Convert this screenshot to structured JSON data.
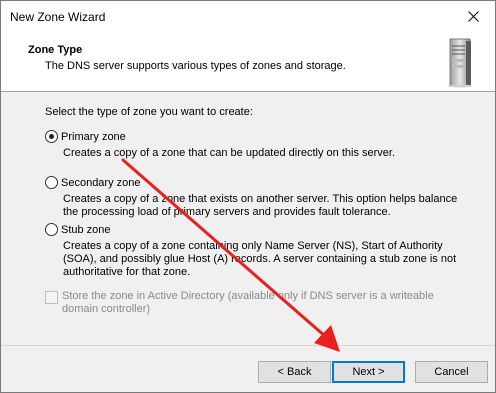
{
  "window": {
    "title": "New Zone Wizard"
  },
  "header": {
    "title": "Zone Type",
    "subtitle": "The DNS server supports various types of zones and storage."
  },
  "prompt": "Select the type of zone you want to create:",
  "zones": [
    {
      "label": "Primary zone",
      "selected": true,
      "description": "Creates a copy of a zone that can be updated directly on this server."
    },
    {
      "label": "Secondary zone",
      "selected": false,
      "description": "Creates a copy of a zone that exists on another server. This option helps balance the processing load of primary servers and provides fault tolerance."
    },
    {
      "label": "Stub zone",
      "selected": false,
      "description": "Creates a copy of a zone containing only Name Server (NS), Start of Authority (SOA), and possibly glue Host (A) records. A server containing a stub zone is not authoritative for that zone."
    }
  ],
  "ad_option": {
    "label": "Store the zone in Active Directory (available only if DNS server is a writeable domain controller)",
    "checked": false,
    "enabled": false
  },
  "buttons": {
    "back": "< Back",
    "next": "Next >",
    "cancel": "Cancel"
  },
  "annotation_color": "#e8201e"
}
